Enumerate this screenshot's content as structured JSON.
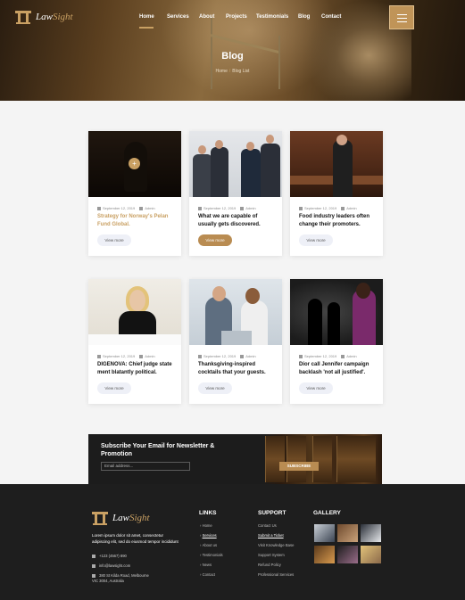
{
  "brand": {
    "name_part1": "Law",
    "name_part2": "Sight"
  },
  "nav": {
    "items": [
      "Home",
      "Services",
      "About",
      "Projects",
      "Testimonials",
      "Blog",
      "Contact"
    ]
  },
  "hero": {
    "title": "Blog",
    "breadcrumb_home": "Home",
    "breadcrumb_sep": "/",
    "breadcrumb_current": "Blog List"
  },
  "posts": [
    {
      "date": "September 12, 2019",
      "author": "Admin",
      "title": "Strategy for Norway's Pelan Fund Global.",
      "button": "View more"
    },
    {
      "date": "September 12, 2019",
      "author": "Admin",
      "title": "What we are capable of usually gets discovered.",
      "button": "View more"
    },
    {
      "date": "September 12, 2019",
      "author": "Admin",
      "title": "Food industry leaders often change their promoters.",
      "button": "View more"
    },
    {
      "date": "September 12, 2019",
      "author": "Admin",
      "title": "DIGENOVA: Chief judge state ment blatantly political.",
      "button": "View more"
    },
    {
      "date": "September 12, 2019",
      "author": "Admin",
      "title": "Thanksgiving-inspired cocktails that your guests.",
      "button": "View more"
    },
    {
      "date": "September 12, 2019",
      "author": "Admin",
      "title": "Dior call Jennifer campaign backlash 'not all justified'.",
      "button": "View more"
    }
  ],
  "newsletter": {
    "title": "Subscribe Your Email for Newsletter & Promotion",
    "placeholder": "Email address...",
    "button": "SUBSCRIBE"
  },
  "footer": {
    "about": "Lorem ipsum dolor sit amet, consectetur adipiscing elit, sed do eiusmod tempor incididunt",
    "phone": "+123 (4567) 890",
    "email": "info@lawsight.com",
    "address": "380 St Kilda Road, Melbourne VIC 3004, Australia",
    "links_title": "LINKS",
    "links": [
      "Home",
      "Services",
      "About us",
      "Testimonials",
      "News",
      "Contact"
    ],
    "support_title": "SUPPORT",
    "support": [
      "Contact Us",
      "Submit a Ticket",
      "Visit Knowledge Base",
      "Support System",
      "Refund Policy",
      "Professional Services"
    ],
    "gallery_title": "GALLERY"
  }
}
